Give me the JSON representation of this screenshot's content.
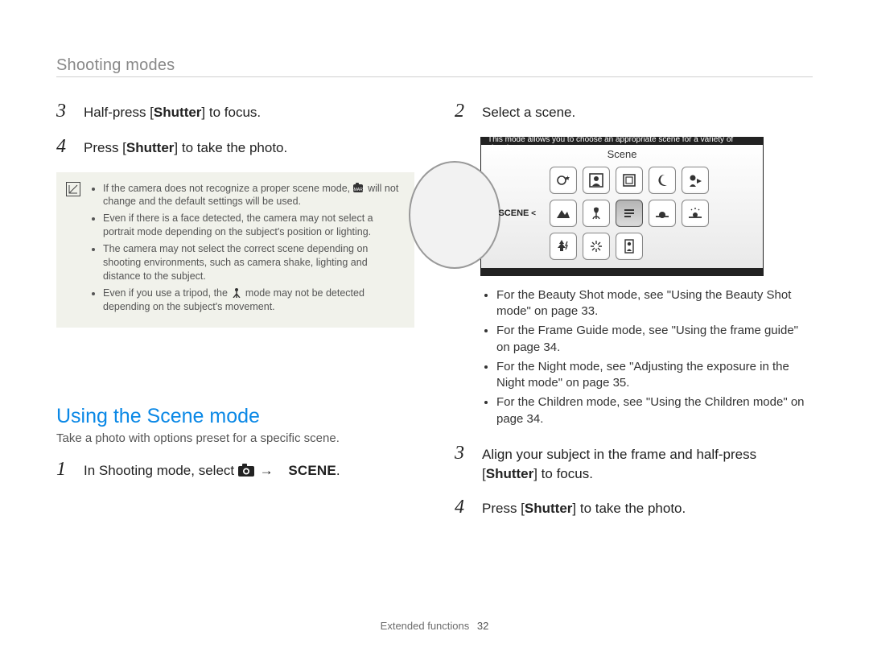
{
  "header": {
    "title": "Shooting modes"
  },
  "left": {
    "steps": [
      {
        "num": "3",
        "before": "Half-press [",
        "key": "Shutter",
        "after": "] to focus."
      },
      {
        "num": "4",
        "before": "Press [",
        "key": "Shutter",
        "after": "] to take the photo."
      }
    ],
    "note": {
      "items": [
        {
          "before": "If the camera does not recognize a proper scene mode, ",
          "after": " will not change and the default settings will be used.",
          "icon": "smart"
        },
        {
          "text": "Even if there is a face detected, the camera may not select a portrait mode depending on the subject's position or lighting."
        },
        {
          "text": "The camera may not select the correct scene depending on shooting environments, such as camera shake, lighting and distance to the subject."
        },
        {
          "before": "Even if you use a tripod, the ",
          "after": " mode may not be detected depending on the subject's movement.",
          "icon": "tripod"
        }
      ]
    },
    "section": {
      "heading": "Using the Scene mode",
      "sub": "Take a photo with options preset for a specific scene.",
      "step1": {
        "num": "1",
        "before": "In Shooting mode, select ",
        "icon_label": "camera-icon",
        "scene_word": "SCENE",
        "after": "."
      }
    }
  },
  "right": {
    "step2": {
      "num": "2",
      "text": "Select a scene."
    },
    "screen": {
      "caption": "This mode allows you to choose an appropriate scene for a variety of situations.",
      "top_label": "Scene",
      "dial_label": "SCENE",
      "icons": [
        "face-star",
        "portrait-frame",
        "frame-guide",
        "moon",
        "profile-play",
        "mountain",
        "tulip",
        "text",
        "sunset",
        "sparkle-sun",
        "tree-flash",
        "fireworks",
        "person-vert"
      ],
      "selected_index": 7
    },
    "bullets": [
      "For the Beauty Shot mode, see \"Using the Beauty Shot mode\" on page 33.",
      "For the Frame Guide mode, see \"Using the frame guide\" on page 34.",
      "For the Night mode, see \"Adjusting the exposure in the Night mode\" on page 35.",
      "For the Children mode, see \"Using the Children mode\" on page 34."
    ],
    "step3": {
      "num": "3",
      "before": "Align your subject in the frame and half-press [",
      "key": "Shutter",
      "after": "] to focus."
    },
    "step4": {
      "num": "4",
      "before": "Press [",
      "key": "Shutter",
      "after": "] to take the photo."
    }
  },
  "footer": {
    "section": "Extended functions",
    "page": "32"
  }
}
